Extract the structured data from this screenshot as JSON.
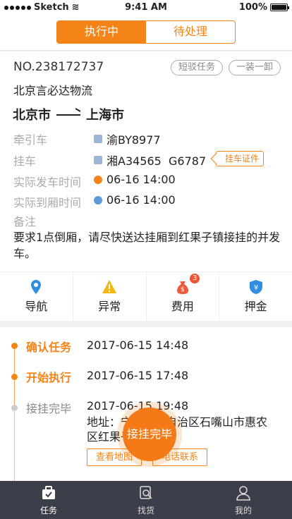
{
  "status": {
    "carrier": "Sketch",
    "time": "9:41 AM",
    "battery": "100%"
  },
  "tabs": [
    "执行中",
    "待处理"
  ],
  "order": {
    "no": "NO.238172737",
    "tags": [
      "短驳任务",
      "一装一卸"
    ],
    "company": "北京言必达物流",
    "from": "北京市",
    "to": "上海市"
  },
  "fields": {
    "tractor_label": "牵引车",
    "tractor_value": "渝BY8977",
    "trailer_label": "挂车",
    "trailer_value": "湘A34565  G6787",
    "trailer_cert": "挂车证件",
    "depart_label": "实际发车时间",
    "depart_value": "06-16 14:00",
    "arrive_label": "实际到厢时间",
    "arrive_value": "06-16 14:00",
    "note_label": "备注",
    "note_value": "要求1点倒厢，请尽快送达挂厢到红果子镇接挂的并发车。"
  },
  "tools": [
    {
      "label": "导航",
      "icon": "location-pin-icon"
    },
    {
      "label": "异常",
      "icon": "warning-icon"
    },
    {
      "label": "费用",
      "icon": "money-bag-icon",
      "badge": "3"
    },
    {
      "label": "押金",
      "icon": "shield-yen-icon"
    }
  ],
  "timeline": [
    {
      "label": "确认任务",
      "time": "2017-06-15 14:48"
    },
    {
      "label": "开始执行",
      "time": "2017-06-15 17:48"
    },
    {
      "label": "接挂完毕",
      "time": "2017-06-15 19:48",
      "address": "地址：宁夏回族自治区石嘴山市惠农区红果子镇"
    }
  ],
  "timeline_buttons": [
    "查看地图",
    "电话联系"
  ],
  "fab": "接挂完毕",
  "tabbar": [
    {
      "label": "任务",
      "icon": "briefcase-icon"
    },
    {
      "label": "找货",
      "icon": "search-doc-icon"
    },
    {
      "label": "我的",
      "icon": "user-icon"
    }
  ],
  "colors": {
    "accent": "#f48417",
    "tabbar": "#3c3f49"
  }
}
